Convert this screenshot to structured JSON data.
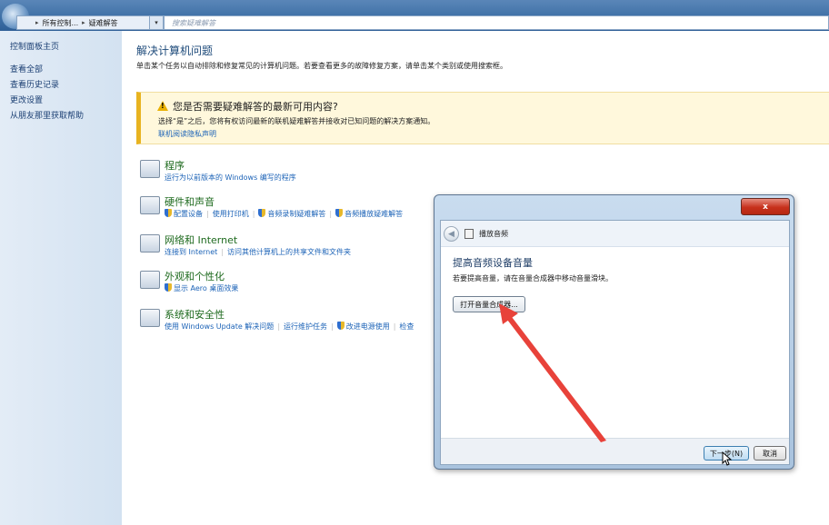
{
  "address": {
    "crumb1": "所有控制...",
    "crumb2": "疑难解答",
    "search_placeholder": "搜索疑难解答"
  },
  "sidebar": {
    "items": [
      {
        "label": "控制面板主页"
      },
      {
        "label": "查看全部"
      },
      {
        "label": "查看历史记录"
      },
      {
        "label": "更改设置"
      },
      {
        "label": "从朋友那里获取帮助"
      }
    ]
  },
  "main": {
    "title": "解决计算机问题",
    "subtitle": "单击某个任务以自动排除和修复常见的计算机问题。若要查看更多的故障修复方案，请单击某个类别或使用搜索框。"
  },
  "notice": {
    "title": "您是否需要疑难解答的最新可用内容?",
    "desc": "选择“是”之后，您将有权访问最新的联机疑难解答并接收对已知问题的解决方案通知。",
    "link": "联机阅读隐私声明"
  },
  "categories": [
    {
      "title": "程序",
      "links": [
        "运行为以前版本的 Windows 编写的程序"
      ]
    },
    {
      "title": "硬件和声音",
      "links": [
        "配置设备",
        "使用打印机",
        "音频录制疑难解答",
        "音频播放疑难解答"
      ]
    },
    {
      "title": "网络和 Internet",
      "links": [
        "连接到 Internet",
        "访问其他计算机上的共享文件和文件夹"
      ]
    },
    {
      "title": "外观和个性化",
      "links": [
        "显示 Aero 桌面效果"
      ]
    },
    {
      "title": "系统和安全性",
      "links": [
        "使用 Windows Update 解决问题",
        "运行维护任务",
        "改进电源使用",
        "检查"
      ]
    }
  ],
  "dialog": {
    "close_label": "x",
    "nav_title": "播放音频",
    "heading": "提高音频设备音量",
    "desc": "若要提高音量，请在音量合成器中移动音量滑块。",
    "mixer_button": "打开音量合成器...",
    "next_button": "下一步(N)",
    "cancel_button": "取消"
  },
  "colors": {
    "annotation_arrow": "#e8423a",
    "link": "#1c63b7",
    "category_title": "#1e6a1e"
  }
}
